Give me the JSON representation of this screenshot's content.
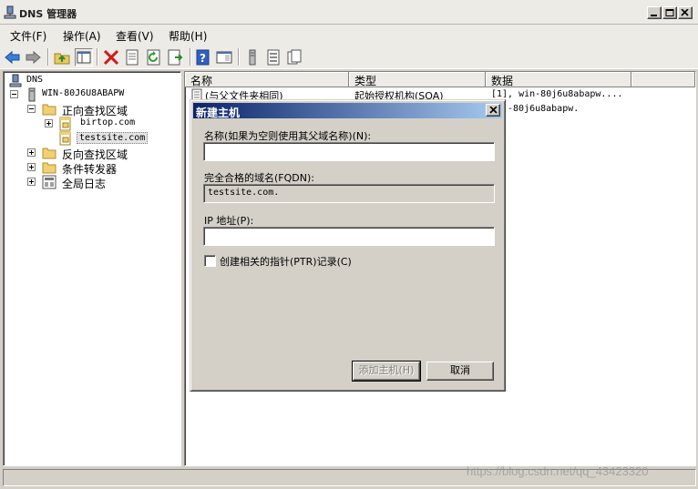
{
  "window": {
    "title": "DNS 管理器"
  },
  "menu": [
    "文件(F)",
    "操作(A)",
    "查看(V)",
    "帮助(H)"
  ],
  "toolbar": [
    "back-icon",
    "forward-icon",
    "up-folder-icon",
    "show-hide-tree-icon",
    "delete-icon",
    "properties-icon",
    "refresh-icon",
    "export-icon",
    "help-icon",
    "console-icon",
    "server-icon",
    "record-icon",
    "copy-icon"
  ],
  "tree": {
    "root": "DNS",
    "server": "WIN-80J6U8ABAPW",
    "forward_zones": "正向查找区域",
    "zone1": "birtop.com",
    "zone2": "testsite.com",
    "reverse_zones": "反向查找区域",
    "conditional": "条件转发器",
    "global_logs": "全局日志"
  },
  "list": {
    "columns": [
      "名称",
      "类型",
      "数据"
    ],
    "rows": [
      {
        "name": "(与父文件夹相同)",
        "type": "起始授权机构(SOA)",
        "data": "[1], win-80j6u8abapw...."
      },
      {
        "name": "",
        "type": "",
        "data": "-80j6u8abapw."
      }
    ]
  },
  "dialog": {
    "title": "新建主机",
    "name_label": "名称(如果为空则使用其父域名称)(N):",
    "name_value": "",
    "fqdn_label": "完全合格的域名(FQDN):",
    "fqdn_value": "testsite.com.",
    "ip_label": "IP 地址(P):",
    "ip_value": "",
    "ptr_label": "创建相关的指针(PTR)记录(C)",
    "ptr_checked": false,
    "add_button": "添加主机(H)",
    "cancel_button": "取消"
  },
  "watermark": "https://blog.csdn.net/qq_43423320"
}
